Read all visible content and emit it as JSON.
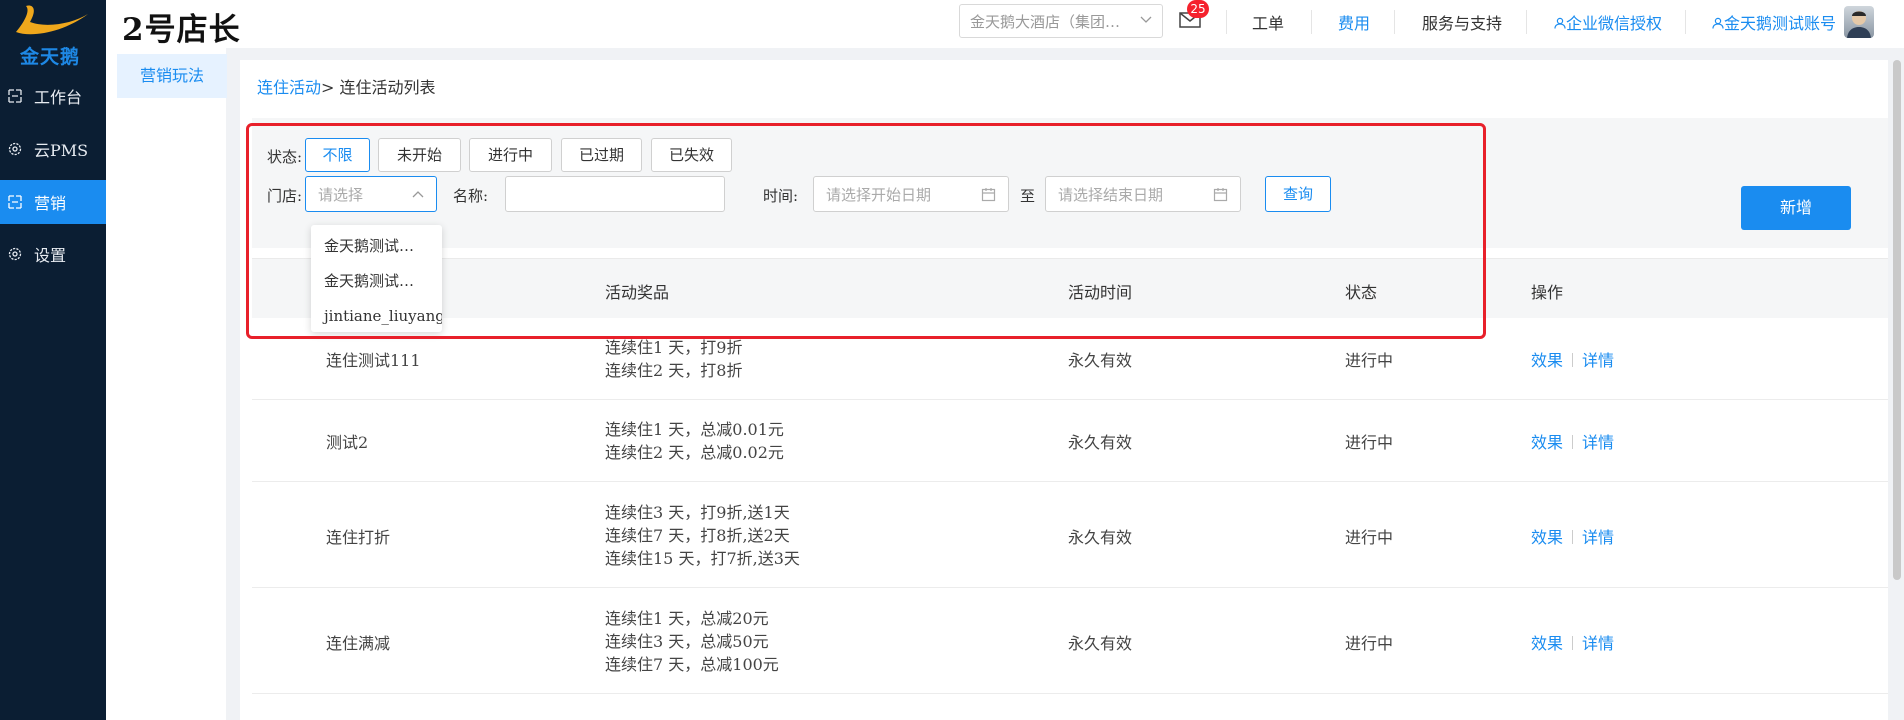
{
  "brand": {
    "logo_text": "金天鹅",
    "app_title": "2号店长",
    "accent_color": "#1a8cf0",
    "sidebar_color": "#0b1e33"
  },
  "sidebar": {
    "items": [
      {
        "label": "工作台",
        "icon": "workbench-icon",
        "active": false
      },
      {
        "label": "云PMS",
        "icon": "gear-icon",
        "active": false
      },
      {
        "label": "营销",
        "icon": "marketing-icon",
        "active": true
      },
      {
        "label": "设置",
        "icon": "gear-icon",
        "active": false
      }
    ]
  },
  "header": {
    "hotel_select": "金天鹅大酒店（集团…",
    "mail_badge": "25",
    "links": {
      "work_order": "工单",
      "fees": "费用",
      "service": "服务与支持",
      "wechat_auth": "企业微信授权",
      "account": "金天鹅测试账号"
    }
  },
  "subnav": {
    "item": "营销玩法"
  },
  "breadcrumb": {
    "parent": "连住活动",
    "separator": ">",
    "current": "连住活动列表"
  },
  "filters": {
    "status_label": "状态:",
    "status_options": [
      "不限",
      "未开始",
      "进行中",
      "已过期",
      "已失效"
    ],
    "selected_status": "不限",
    "store_label": "门店:",
    "store_placeholder": "请选择",
    "name_label": "名称:",
    "name_value": "",
    "time_label": "时间:",
    "start_placeholder": "请选择开始日期",
    "to_label": "至",
    "end_placeholder": "请选择结束日期",
    "query_button": "查询",
    "store_options": [
      "金天鹅测试…",
      "金天鹅测试…",
      "jintiane_liuyang"
    ]
  },
  "add_button": "新增",
  "table": {
    "columns": [
      "活动奖品",
      "活动时间",
      "状态",
      "操作"
    ],
    "rows": [
      {
        "name": "连住测试111",
        "prizes": [
          "连续住1 天，打9折",
          "连续住2 天，打8折"
        ],
        "time": "永久有效",
        "status": "进行中",
        "ops": [
          "效果",
          "详情"
        ]
      },
      {
        "name": "测试2",
        "prizes": [
          "连续住1 天，总减0.01元",
          "连续住2 天，总减0.02元"
        ],
        "time": "永久有效",
        "status": "进行中",
        "ops": [
          "效果",
          "详情"
        ]
      },
      {
        "name": "连住打折",
        "prizes": [
          "连续住3 天，打9折,送1天",
          "连续住7 天，打8折,送2天",
          "连续住15 天，打7折,送3天"
        ],
        "time": "永久有效",
        "status": "进行中",
        "ops": [
          "效果",
          "详情"
        ]
      },
      {
        "name": "连住满减",
        "prizes": [
          "连续住1 天，总减20元",
          "连续住3 天，总减50元",
          "连续住7 天，总减100元"
        ],
        "time": "永久有效",
        "status": "进行中",
        "ops": [
          "效果",
          "详情"
        ]
      }
    ]
  }
}
